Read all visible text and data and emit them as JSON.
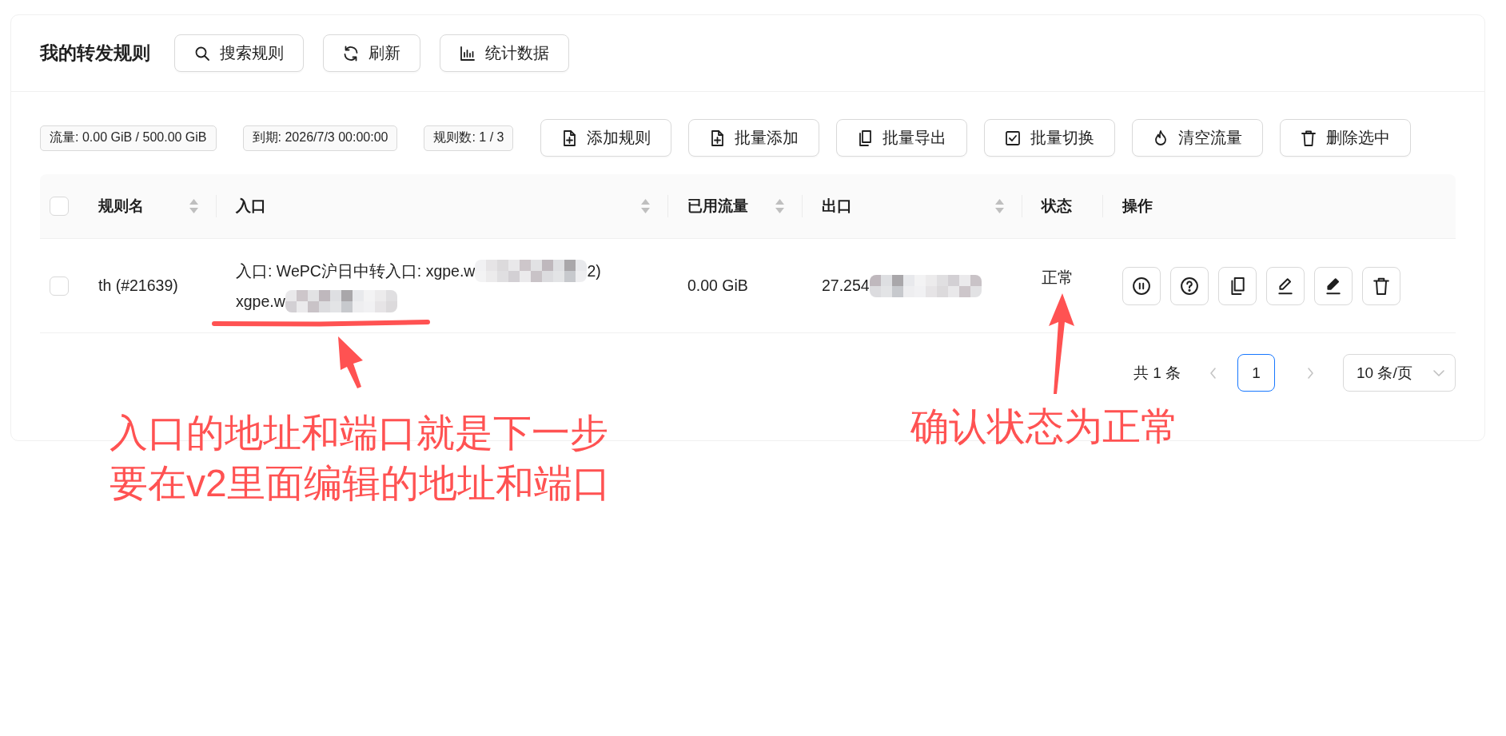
{
  "header": {
    "title": "我的转发规则",
    "buttons": [
      "搜索规则",
      "刷新",
      "统计数据"
    ]
  },
  "toolbar": {
    "stats": [
      "流量: 0.00 GiB / 500.00 GiB",
      "到期: 2026/7/3 00:00:00",
      "规则数: 1 / 3"
    ],
    "buttons": [
      "添加规则",
      "批量添加",
      "批量导出",
      "批量切换",
      "清空流量",
      "删除选中"
    ]
  },
  "table": {
    "select_all_checked": false,
    "columns": [
      {
        "label": "规则名",
        "sortable": true
      },
      {
        "label": "入口",
        "sortable": true
      },
      {
        "label": "已用流量",
        "sortable": true
      },
      {
        "label": "出口",
        "sortable": true
      },
      {
        "label": "状态",
        "sortable": false
      },
      {
        "label": "操作",
        "sortable": false
      }
    ],
    "rows": [
      {
        "checked": false,
        "name": "th (#21639)",
        "entry": [
          [
            {
              "kind": "text",
              "text": "入口: WePC沪日中转入口: xgpe.w"
            },
            {
              "kind": "redacted"
            },
            {
              "kind": "text",
              "text": "2)"
            }
          ],
          [
            {
              "kind": "text",
              "text": "xgpe.w"
            },
            {
              "kind": "redacted"
            }
          ]
        ],
        "used": "0.00 GiB",
        "exit": [
          {
            "kind": "text",
            "text": "27.254"
          },
          {
            "kind": "redacted"
          }
        ],
        "status": "正常"
      }
    ]
  },
  "pagination": {
    "total": "共 1 条",
    "prev_disabled": true,
    "pages": [
      {
        "label": "1",
        "selected": true
      }
    ],
    "next_disabled": true,
    "page_size": "10 条/页"
  },
  "annotations": {
    "entry_note": {
      "lines": [
        "入口的地址和端口就是下一步",
        "要在v2里面编辑的地址和端口"
      ]
    },
    "status_note": {
      "lines": [
        "确认状态为正常"
      ]
    }
  }
}
